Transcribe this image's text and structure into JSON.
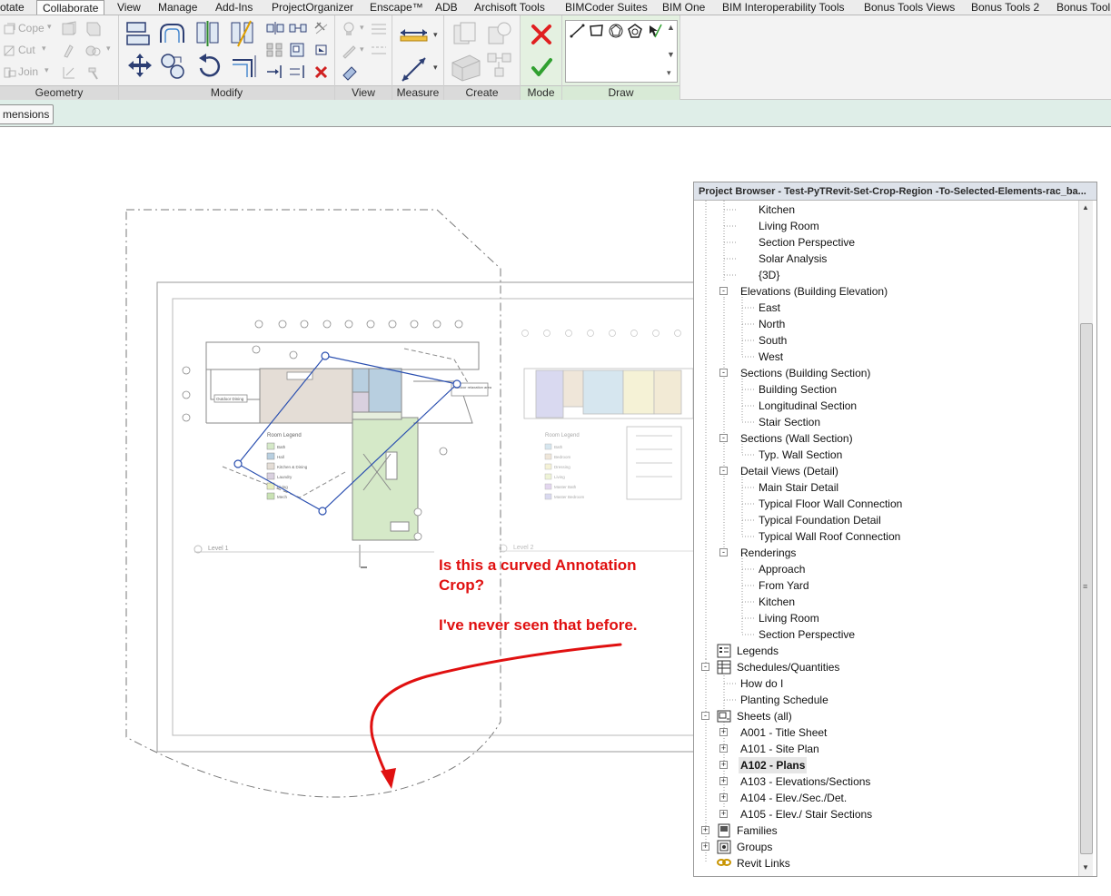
{
  "tabs": [
    "otate",
    "Collaborate",
    "View",
    "Manage",
    "Add-Ins",
    "ProjectOrganizer",
    "Enscape™",
    "ADB",
    "Archisoft Tools",
    "BIMCoder Suites",
    "BIM One",
    "BIM Interoperability Tools",
    "Bonus Tools Views",
    "Bonus Tools 2",
    "Bonus Tool"
  ],
  "active_tab": "Collaborate",
  "ribbon": {
    "geometry_labels": {
      "cope": "Cope",
      "cut": "Cut",
      "join": "Join"
    },
    "panels": {
      "geometry": "Geometry",
      "modify": "Modify",
      "view": "View",
      "measure": "Measure",
      "create": "Create",
      "mode": "Mode",
      "draw": "Draw"
    }
  },
  "options_bar": {
    "button_label": "mensions"
  },
  "drawing": {
    "level_left": "Level 1",
    "level_right": "Level 2",
    "room_legend": "Room Legend",
    "legend_left": [
      "Bath",
      "Hall",
      "Kitchen & Dining",
      "Laundry",
      "Living",
      "Mech"
    ],
    "legend_right": [
      "Bath",
      "Bedroom",
      "Dressing",
      "Living",
      "Master Bath",
      "Master Bedroom"
    ],
    "tag_outdoor_dining": "Outdoor Dining",
    "tag_outdoor_area": "Outdoor relaxation area"
  },
  "annotation": {
    "line1": "Is this a curved Annotation",
    "line2": "Crop?",
    "line3": "I've never seen that before.",
    "color": "#e01010"
  },
  "project_browser": {
    "title": "Project Browser - Test-PyTRevit-Set-Crop-Region -To-Selected-Elements-rac_ba...",
    "rows": [
      "Kitchen",
      "Living Room",
      "Section Perspective",
      "Solar Analysis",
      "{3D}",
      "Elevations (Building Elevation)",
      "East",
      "North",
      "South",
      "West",
      "Sections (Building Section)",
      "Building Section",
      "Longitudinal Section",
      "Stair Section",
      "Sections (Wall Section)",
      "Typ. Wall Section",
      "Detail Views (Detail)",
      "Main Stair Detail",
      "Typical Floor Wall Connection",
      "Typical Foundation Detail",
      "Typical Wall Roof Connection",
      "Renderings",
      "Approach",
      "From Yard",
      "Kitchen",
      "Living Room",
      "Section Perspective",
      "Legends",
      "Schedules/Quantities",
      "How do I",
      "Planting Schedule",
      "Sheets (all)",
      "A001 - Title Sheet",
      "A101 - Site Plan",
      "A102 - Plans",
      "A103 - Elevations/Sections",
      "A104 - Elev./Sec./Det.",
      "A105 - Elev./ Stair Sections",
      "Families",
      "Groups",
      "Revit Links"
    ],
    "selected": "A102 - Plans"
  }
}
